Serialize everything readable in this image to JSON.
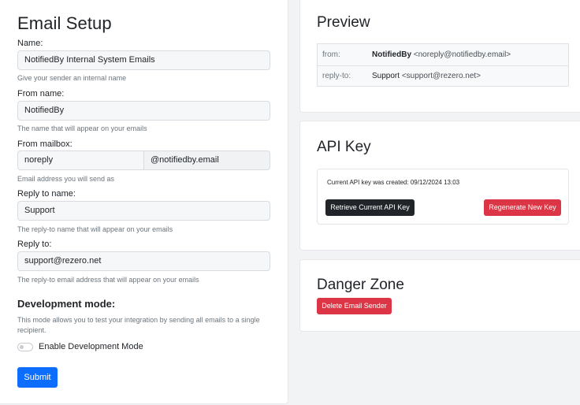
{
  "setup": {
    "title": "Email Setup",
    "name": {
      "label": "Name:",
      "value": "NotifiedBy Internal System Emails",
      "help": "Give your sender an internal name"
    },
    "from_name": {
      "label": "From name:",
      "value": "NotifiedBy",
      "help": "The name that will appear on your emails"
    },
    "from_mailbox": {
      "label": "From mailbox:",
      "value": "noreply",
      "domain": "@notifiedby.email",
      "help": "Email address you will send as"
    },
    "reply_name": {
      "label": "Reply to name:",
      "value": "Support",
      "help": "The reply-to name that will appear on your emails"
    },
    "reply_to": {
      "label": "Reply to:",
      "value": "support@rezero.net",
      "help": "The reply-to email address that will appear on your emails"
    },
    "dev_mode": {
      "title": "Development mode:",
      "description": "This mode allows you to test your integration by sending all emails to a single recipient.",
      "toggle_label": "Enable Development Mode",
      "enabled": false
    },
    "submit_label": "Submit"
  },
  "preview": {
    "title": "Preview",
    "from": {
      "key": "from:",
      "name": "NotifiedBy",
      "address": "<noreply@notifiedby.email>"
    },
    "reply_to": {
      "key": "reply-to:",
      "name": "Support",
      "address": "<support@rezero.net>"
    }
  },
  "api_key": {
    "title": "API Key",
    "created_text": "Current API key was created: 09/12/2024 13:03",
    "retrieve_label": "Retrieve Current API Key",
    "regenerate_label": "Regenerate New Key"
  },
  "danger": {
    "title": "Danger Zone",
    "delete_label": "Delete Email Sender"
  },
  "colors": {
    "primary": "#0d6efd",
    "danger": "#dc3545",
    "dark": "#212529"
  }
}
